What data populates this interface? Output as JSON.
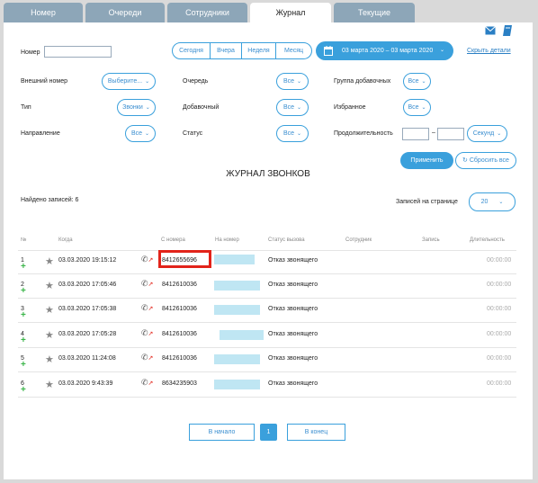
{
  "tabs": [
    "Номер",
    "Очереди",
    "Сотрудники",
    "Журнал",
    "Текущие"
  ],
  "filters": {
    "number_label": "Номер",
    "quick": [
      "Сегодня",
      "Вчера",
      "Неделя",
      "Месяц"
    ],
    "date_range": "03 марта 2020 – 03 марта 2020",
    "hide_details": "Скрыть детали",
    "ext_number_label": "Внешний номер",
    "ext_number_value": "Выберите...",
    "queue_label": "Очередь",
    "queue_value": "Все",
    "group_label": "Группа добавочных",
    "group_value": "Все",
    "type_label": "Тип",
    "type_value": "Звонки",
    "extension_label": "Добавочный",
    "extension_value": "Все",
    "favorite_label": "Избранное",
    "favorite_value": "Все",
    "direction_label": "Направление",
    "direction_value": "Все",
    "status_label": "Статус",
    "status_value": "Все",
    "duration_label": "Продолжительность",
    "duration_dash": "–",
    "duration_unit": "Секунд",
    "apply": "Применить",
    "reset": "Сбросить все"
  },
  "journal": {
    "title": "ЖУРНАЛ ЗВОНКОВ",
    "found": "Найдено записей: 6",
    "per_page_label": "Записей на странице",
    "per_page_value": "20",
    "columns": [
      "№",
      "Когда",
      "С номера",
      "На номер",
      "Статус вызова",
      "Сотрудник",
      "Запись",
      "Длительность"
    ],
    "rows": [
      {
        "n": "1",
        "when": "03.03.2020 19:15:12",
        "from": "8412655696",
        "status": "Отказ звонящего",
        "duration": "00:00:00"
      },
      {
        "n": "2",
        "when": "03.03.2020 17:05:46",
        "from": "8412610036",
        "status": "Отказ звонящего",
        "duration": "00:00:00"
      },
      {
        "n": "3",
        "when": "03.03.2020 17:05:38",
        "from": "8412610036",
        "status": "Отказ звонящего",
        "duration": "00:00:00"
      },
      {
        "n": "4",
        "when": "03.03.2020 17:05:28",
        "from": "8412610036",
        "status": "Отказ звонящего",
        "duration": "00:00:00"
      },
      {
        "n": "5",
        "when": "03.03.2020 11:24:08",
        "from": "8412610036",
        "status": "Отказ звонящего",
        "duration": "00:00:00"
      },
      {
        "n": "6",
        "when": "03.03.2020 9:43:39",
        "from": "8634235903",
        "status": "Отказ звонящего",
        "duration": "00:00:00"
      }
    ]
  },
  "pagination": {
    "first": "В начало",
    "current": "1",
    "last": "В конец"
  },
  "colors": {
    "accent": "#3aa0dc",
    "highlight": "#e2231a",
    "tab_inactive": "#8da6b8"
  }
}
